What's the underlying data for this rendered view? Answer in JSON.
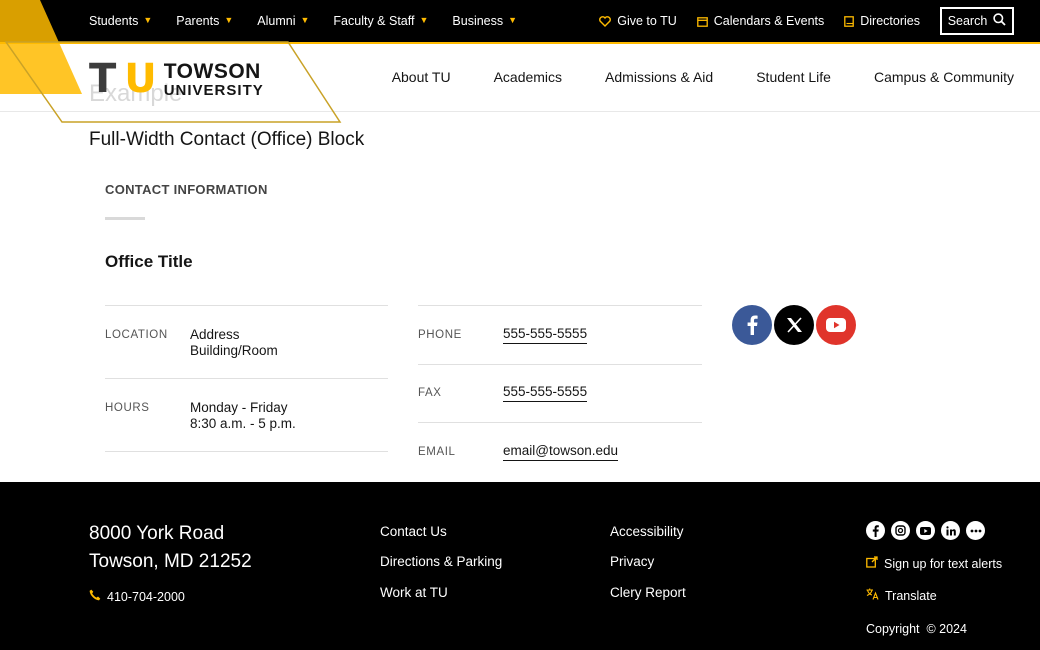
{
  "utility": {
    "audience": [
      {
        "label": "Students"
      },
      {
        "label": "Parents"
      },
      {
        "label": "Alumni"
      },
      {
        "label": "Faculty & Staff"
      },
      {
        "label": "Business"
      }
    ],
    "links": [
      {
        "label": "Give to TU",
        "icon": "heart-icon"
      },
      {
        "label": "Calendars & Events",
        "icon": "calendar-icon"
      },
      {
        "label": "Directories",
        "icon": "book-icon"
      }
    ],
    "search_label": "Search"
  },
  "logo": {
    "mark": "TU",
    "line1": "TOWSON",
    "line2": "UNIVERSITY"
  },
  "nav": [
    {
      "label": "About TU"
    },
    {
      "label": "Academics"
    },
    {
      "label": "Admissions & Aid"
    },
    {
      "label": "Student Life"
    },
    {
      "label": "Campus & Community"
    }
  ],
  "page": {
    "ghost_title": "Example",
    "block_title": "Full-Width Contact (Office) Block",
    "contact_label": "CONTACT INFORMATION",
    "office_title": "Office Title"
  },
  "contact": {
    "location_label": "LOCATION",
    "location_line1": "Address",
    "location_line2": "Building/Room",
    "hours_label": "HOURS",
    "hours_line1": "Monday - Friday",
    "hours_line2": "8:30 a.m. - 5 p.m.",
    "phone_label": "PHONE",
    "phone": "555-555-5555",
    "fax_label": "FAX",
    "fax": "555-555-5555",
    "email_label": "EMAIL",
    "email": "email@towson.edu"
  },
  "socials": [
    {
      "name": "facebook",
      "color": "#3b5998"
    },
    {
      "name": "x",
      "color": "#000000"
    },
    {
      "name": "youtube",
      "color": "#e0342b"
    }
  ],
  "footer": {
    "address_line1": "8000 York Road",
    "address_line2": "Towson, MD 21252",
    "phone": "410-704-2000",
    "col1": [
      {
        "label": "Contact Us"
      },
      {
        "label": "Directions & Parking"
      },
      {
        "label": "Work at TU"
      }
    ],
    "col2": [
      {
        "label": "Accessibility"
      },
      {
        "label": "Privacy"
      },
      {
        "label": "Clery Report"
      }
    ],
    "text_alerts": "Sign up for text alerts",
    "translate": "Translate",
    "copyright": "Copyright  © 2024"
  },
  "colors": {
    "gold": "#ffbb00",
    "black": "#000000"
  }
}
